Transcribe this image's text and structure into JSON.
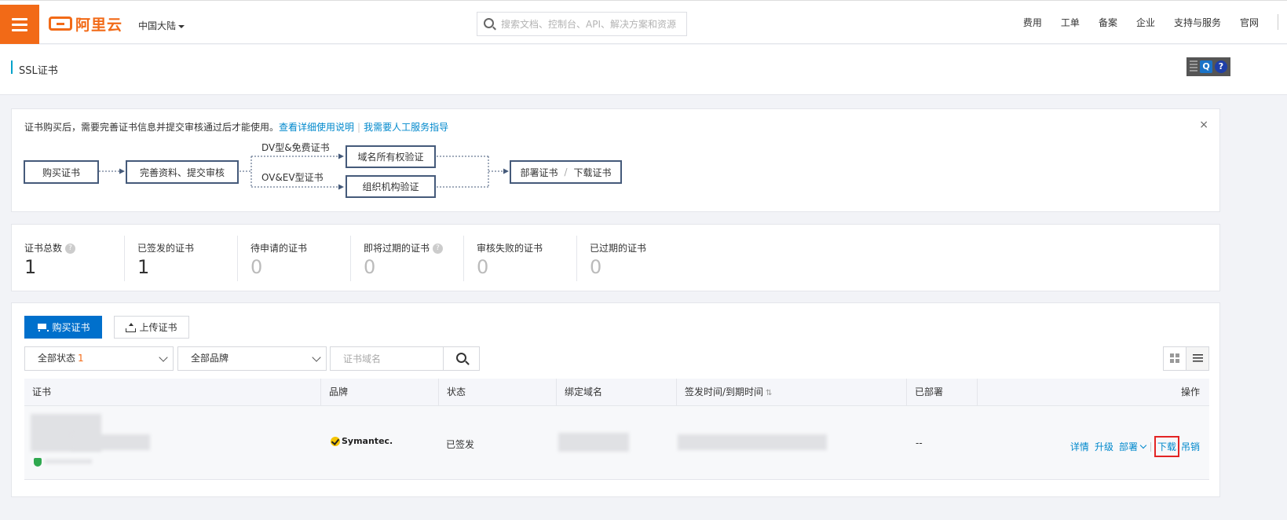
{
  "header": {
    "logo_text": "阿里云",
    "region": "中国大陆",
    "search_placeholder": "搜索文档、控制台、API、解决方案和资源",
    "nav": [
      "费用",
      "工单",
      "备案",
      "企业",
      "支持与服务",
      "官网"
    ]
  },
  "page": {
    "title": "SSL证书",
    "widget_q": "Q",
    "widget_help": "?"
  },
  "guide": {
    "text": "证书购买后，需要完善证书信息并提交审核通过后才能使用。",
    "link1": "查看详细使用说明",
    "link2": "我需要人工服务指导",
    "close": "×",
    "steps": {
      "buy": "购买证书",
      "complete": "完善资料、提交审核",
      "dv_label": "DV型&免费证书",
      "ov_label": "OV&EV型证书",
      "domain_verify": "域名所有权验证",
      "org_verify": "组织机构验证",
      "deploy": "部署证书",
      "deploy_sep": "/",
      "download": "下载证书"
    }
  },
  "stats": [
    {
      "label": "证书总数",
      "value": "1",
      "help": true
    },
    {
      "label": "已签发的证书",
      "value": "1",
      "help": false
    },
    {
      "label": "待申请的证书",
      "value": "0",
      "help": false
    },
    {
      "label": "即将过期的证书",
      "value": "0",
      "help": true
    },
    {
      "label": "审核失败的证书",
      "value": "0",
      "help": false
    },
    {
      "label": "已过期的证书",
      "value": "0",
      "help": false
    }
  ],
  "list": {
    "buy_button": "购买证书",
    "upload_button": "上传证书",
    "status_filter": "全部状态",
    "status_count": "1",
    "brand_filter": "全部品牌",
    "domain_placeholder": "证书域名",
    "columns": [
      "证书",
      "品牌",
      "状态",
      "绑定域名",
      "签发时间/到期时间",
      "已部署",
      "操作"
    ],
    "row": {
      "brand": "Symantec.",
      "status": "已签发",
      "deployed": "--",
      "ops": {
        "detail": "详情",
        "upgrade": "升级",
        "deploy": "部署",
        "download": "下载",
        "revoke": "吊销"
      }
    }
  }
}
